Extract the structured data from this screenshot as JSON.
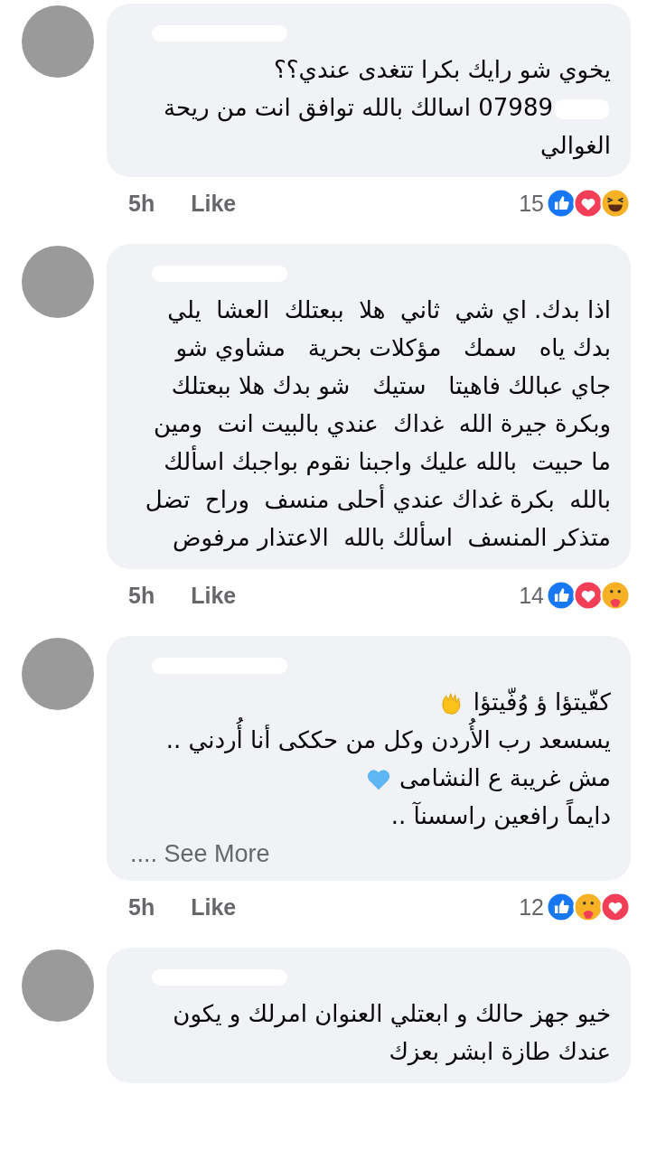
{
  "comments": [
    {
      "body": [
        {
          "kind": "plain",
          "text": "يخوي شو رايك بكرا تتغدى عندي؟؟"
        },
        {
          "kind": "plain",
          "text": "07989 اسالك بالله توافق انت من ريحة الغوالي",
          "redacted_after_number": true
        }
      ],
      "time": "5h",
      "like": "Like",
      "reaction_count": "15",
      "reactions": [
        {
          "kind": "like"
        },
        {
          "kind": "love"
        },
        {
          "kind": "haha"
        }
      ]
    },
    {
      "body": [
        {
          "kind": "plain",
          "text": "اذا بدك. اي شي  ثاني  هلا  ببعتلك  العشا  يلي بدك ياه   سمك   مؤكلات بحرية   مشاوي شو جاي عبالك فاهيتا   ستيك   شو بدك هلا ببعتلك"
        },
        {
          "kind": "plain",
          "text": "وبكرة جيرة الله  غداك  عندي بالبيت انت  ومين ما حبيت  بالله عليك واجبنا نقوم بواجبك اسألك بالله  بكرة غداك عندي أحلى منسف  وراح  تضل متذكر المنسف  اسألك بالله  الاعتذار مرفوض"
        }
      ],
      "time": "5h",
      "like": "Like",
      "reaction_count": "14",
      "reactions": [
        {
          "kind": "like"
        },
        {
          "kind": "love"
        },
        {
          "kind": "care"
        }
      ]
    },
    {
      "body": [
        {
          "kind": "clap",
          "text": "كفّيتؤا ؤ وُفّيتؤا"
        },
        {
          "kind": "plain",
          "text": "يسسعد رب الأُردن وكل من حككى أنا أُردني .."
        },
        {
          "kind": "heart",
          "text": "مش غريبة ع النشامى"
        },
        {
          "kind": "plain",
          "text": "دايماً رافعين راسسنآ .."
        }
      ],
      "see_more": ".... See More",
      "time": "5h",
      "like": "Like",
      "reaction_count": "12",
      "reactions": [
        {
          "kind": "like"
        },
        {
          "kind": "care"
        },
        {
          "kind": "love"
        }
      ]
    },
    {
      "body": [
        {
          "kind": "plain",
          "text": "خيو جهز حالك و ابعتلي العنوان امرلك و يكون عندك طازة ابشر بعزك"
        }
      ]
    }
  ]
}
